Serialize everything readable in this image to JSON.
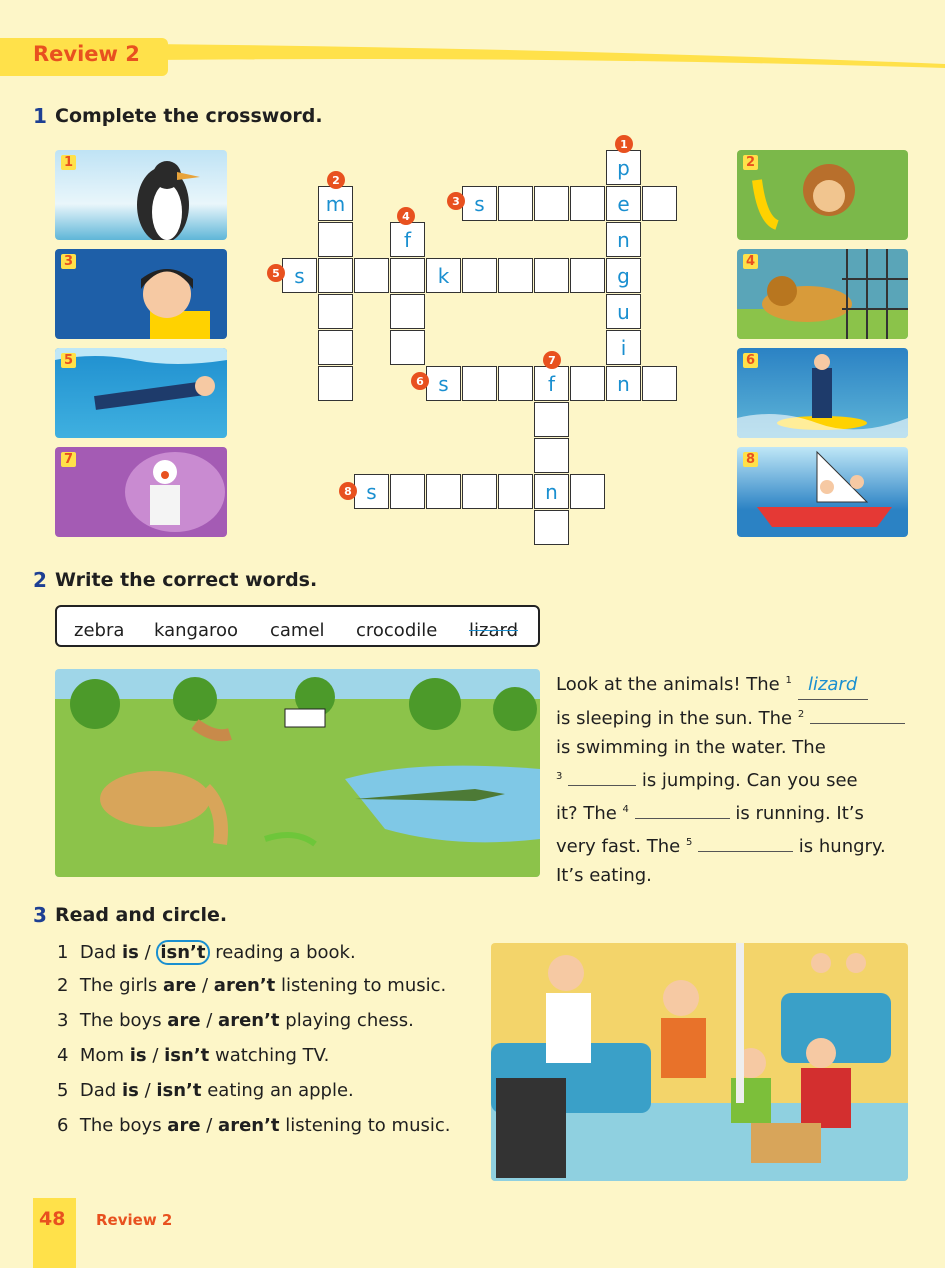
{
  "header": {
    "title": "Review 2"
  },
  "section1": {
    "number": "1",
    "title": "Complete the crossword.",
    "pictures": [
      "1",
      "2",
      "3",
      "4",
      "5",
      "6",
      "7",
      "8"
    ],
    "letters": {
      "p": "p",
      "e": "e",
      "n": "n",
      "g": "g",
      "u": "u",
      "i": "i",
      "m": "m",
      "s": "s",
      "f": "f",
      "k": "k"
    }
  },
  "section2": {
    "number": "2",
    "title": "Write the correct words.",
    "words": [
      "zebra",
      "kangaroo",
      "camel",
      "crocodile",
      "lizard"
    ],
    "story": {
      "s1a": "Look at the animals! The ",
      "n1": "1",
      "a1": "lizard",
      "s1b": "is sleeping in the sun. The ",
      "n2": "2",
      "s2b": "is swimming in the water. The",
      "n3": "3",
      "s3b": " is jumping. Can you see",
      "s4a": "it? The ",
      "n4": "4",
      "s4b": " is running. It’s",
      "s5a": "very fast. The ",
      "n5": "5",
      "s5b": " is hungry.",
      "s6": "It’s eating."
    }
  },
  "section3": {
    "number": "3",
    "title": "Read and circle.",
    "items": [
      {
        "n": "1",
        "pre": "Dad ",
        "a": "is",
        "sep": " / ",
        "b": "isn’t",
        "post": " reading a book."
      },
      {
        "n": "2",
        "pre": "The girls ",
        "a": "are",
        "sep": " / ",
        "b": "aren’t",
        "post": " listening to music."
      },
      {
        "n": "3",
        "pre": "The boys ",
        "a": "are",
        "sep": " / ",
        "b": "aren’t",
        "post": " playing chess."
      },
      {
        "n": "4",
        "pre": "Mom ",
        "a": "is",
        "sep": " / ",
        "b": "isn’t",
        "post": " watching TV."
      },
      {
        "n": "5",
        "pre": "Dad ",
        "a": "is",
        "sep": " / ",
        "b": "isn’t",
        "post": " eating an apple."
      },
      {
        "n": "6",
        "pre": "The boys ",
        "a": "are",
        "sep": " / ",
        "b": "aren’t",
        "post": " listening to music."
      }
    ]
  },
  "footer": {
    "page": "48",
    "label": "Review 2"
  },
  "colors": {
    "accent": "#e8511f",
    "answer": "#1a8fd0",
    "banner": "#ffe14a",
    "page": "#fdf6c8"
  }
}
